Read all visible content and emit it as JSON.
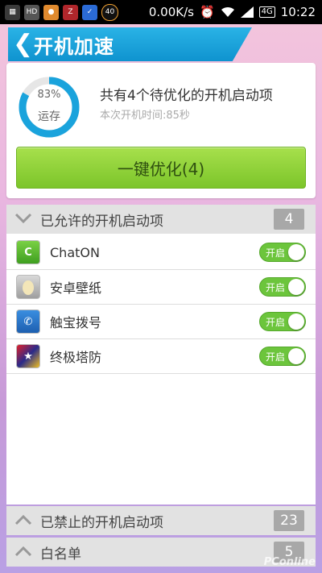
{
  "statusbar": {
    "net_speed": "0.00K/s",
    "time": "10:22",
    "signal_label": "4G",
    "badge": "40"
  },
  "header": {
    "title": "开机加速"
  },
  "summary": {
    "percent": "83%",
    "percent_value": 0.83,
    "ring_label": "运存",
    "title": "共有4个待优化的开机启动项",
    "subtitle": "本次开机时间:85秒",
    "optimize_button": "一键优化(4)"
  },
  "allowed": {
    "title": "已允许的开机启动项",
    "count": "4",
    "items": [
      {
        "name": "ChatON",
        "toggle": "开启"
      },
      {
        "name": "安卓壁纸",
        "toggle": "开启"
      },
      {
        "name": "触宝拨号",
        "toggle": "开启"
      },
      {
        "name": "终极塔防",
        "toggle": "开启"
      }
    ]
  },
  "blocked": {
    "title": "已禁止的开机启动项",
    "count": "23"
  },
  "whitelist": {
    "title": "白名单",
    "count": "5"
  },
  "watermark": "PConline",
  "colors": {
    "accent": "#1aa3dc",
    "green": "#7cc52a",
    "toggle_on": "#6cc53c"
  }
}
